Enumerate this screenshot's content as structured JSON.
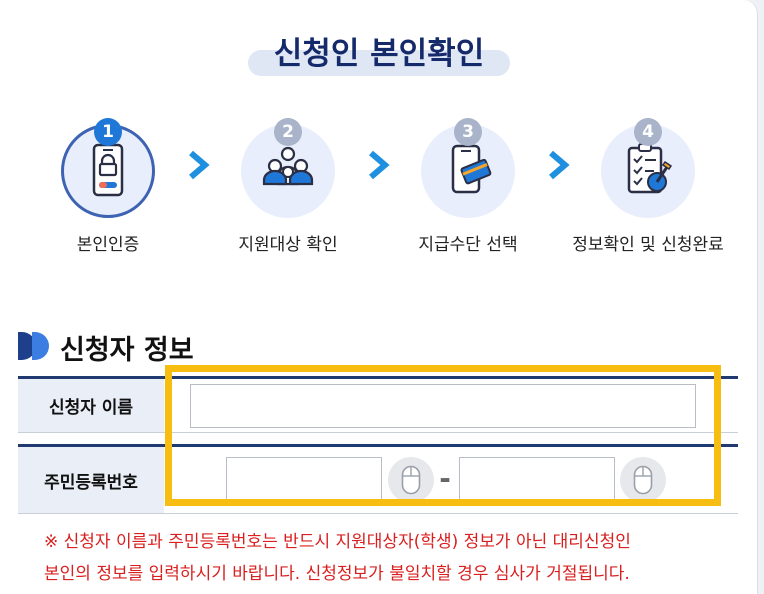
{
  "title": "신청인 본인확인",
  "steps": [
    {
      "number": "1",
      "label": "본인인증",
      "icon": "phone-lock-icon",
      "active": true
    },
    {
      "number": "2",
      "label": "지원대상 확인",
      "icon": "group-people-icon",
      "active": false
    },
    {
      "number": "3",
      "label": "지급수단 선택",
      "icon": "phone-card-icon",
      "active": false
    },
    {
      "number": "4",
      "label": "정보확인 및 신청완료",
      "icon": "checklist-icon",
      "active": false
    }
  ],
  "section": {
    "title": "신청자 정보"
  },
  "form": {
    "name_label": "신청자 이름",
    "name_value": "",
    "rrn_label": "주민등록번호",
    "rrn_front_value": "",
    "rrn_back_value": "",
    "rrn_separator": "-"
  },
  "notice": {
    "line1": "※ 신청자 이름과 주민등록번호는 반드시 지원대상자(학생) 정보가 아닌 대리신청인",
    "line2": "본인의 정보를 입력하시기 바랍니다. 신청정보가 불일치할 경우 심사가 거절됩니다."
  },
  "colors": {
    "title": "#152a6b",
    "accent_blue": "#1f78d8",
    "highlight": "#f7bd10",
    "notice": "#d91f1f",
    "header_cell": "#e9eef7"
  }
}
